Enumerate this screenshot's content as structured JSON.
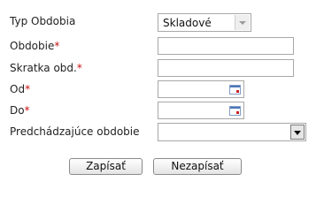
{
  "form": {
    "typ_obdobia": {
      "label": "Typ Obdobia",
      "value": "Skladové"
    },
    "obdobie": {
      "label": "Obdobie",
      "required_mark": "*",
      "value": ""
    },
    "skratka": {
      "label": "Skratka obd.",
      "required_mark": "*",
      "value": ""
    },
    "od": {
      "label": "Od",
      "required_mark": "*",
      "value": ""
    },
    "do": {
      "label": "Do",
      "required_mark": "*",
      "value": ""
    },
    "predchadzajuce": {
      "label": "Predchádzajúce obdobie",
      "value": ""
    }
  },
  "buttons": {
    "save_label": "Zapísať",
    "cancel_label": "Nezapísať"
  },
  "icons": {
    "calendar": "calendar-icon",
    "dropdown": "chevron-down-icon"
  },
  "colors": {
    "required": "#cc1111",
    "border": "#a8a8a8"
  }
}
